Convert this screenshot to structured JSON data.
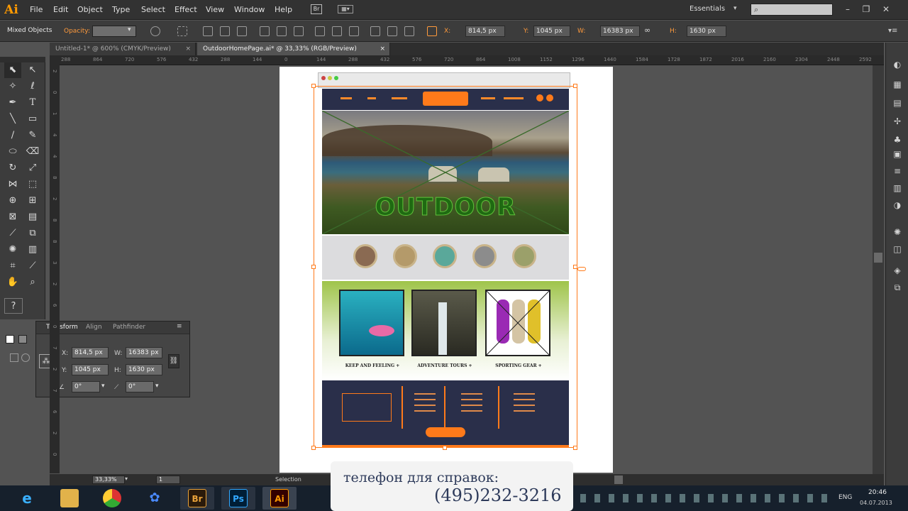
{
  "app": {
    "logo": "Ai",
    "menu": [
      "File",
      "Edit",
      "Object",
      "Type",
      "Select",
      "Effect",
      "View",
      "Window",
      "Help"
    ],
    "bridge_btn": "Br",
    "workspace": "Essentials",
    "search_placeholder": ""
  },
  "control_bar": {
    "selection_type": "Mixed Objects",
    "opacity_label": "Opacity:",
    "x_label": "X:",
    "x_value": "814,5 px",
    "y_label": "Y:",
    "y_value": "1045 px",
    "w_label": "W:",
    "w_value": "16383 px",
    "h_label": "H:",
    "h_value": "1630 px"
  },
  "tabs": [
    {
      "label": "Untitled-1* @ 600% (CMYK/Preview)",
      "close": "×"
    },
    {
      "label": "OutdoorHomePage.ai* @ 33,33% (RGB/Preview)",
      "close": "×"
    }
  ],
  "ruler": {
    "h_ticks": [
      "288",
      "864",
      "720",
      "576",
      "432",
      "288",
      "144",
      "0",
      "144",
      "288",
      "432",
      "576",
      "720",
      "864",
      "1008",
      "1152",
      "1296",
      "1440",
      "1584",
      "1728",
      "1872",
      "2016",
      "2160",
      "2304",
      "2448",
      "2592"
    ],
    "v_ticks": [
      "2",
      "0",
      "1",
      "4",
      "4",
      "8",
      "2",
      "8",
      "8",
      "3",
      "2",
      "6",
      "0",
      "7",
      "2",
      "7",
      "6",
      "2",
      "0"
    ]
  },
  "transform_panel": {
    "tabs": [
      "Transform",
      "Align",
      "Pathfinder"
    ],
    "x_label": "X:",
    "x_value": "814,5 px",
    "y_label": "Y:",
    "y_value": "1045 px",
    "w_label": "W:",
    "w_value": "16383 px",
    "h_label": "H:",
    "h_value": "1630 px",
    "angle_value": "0°",
    "shear_value": "0°"
  },
  "artboard": {
    "hero_text": "OUTDOOR",
    "cards": [
      "KEEP AND FEELING +",
      "ADVENTURE TOURS +",
      "SPORTING GEAR +"
    ]
  },
  "status_bar": {
    "zoom": "33,33%",
    "page": "1",
    "tool": "Selection"
  },
  "taskbar": {
    "apps": [
      "ie",
      "explorer",
      "chrome",
      "ayu",
      "Br",
      "Ps",
      "Ai"
    ],
    "lang": "ENG",
    "time": "20:46",
    "date": "04.07.2013"
  },
  "overlay": {
    "line1": "телефон для справок:",
    "line2": "(495)232-3216"
  },
  "colors": {
    "accent": "#ff7a1a",
    "ai_brand": "#ff9a00",
    "navy": "#2a2f4a"
  }
}
